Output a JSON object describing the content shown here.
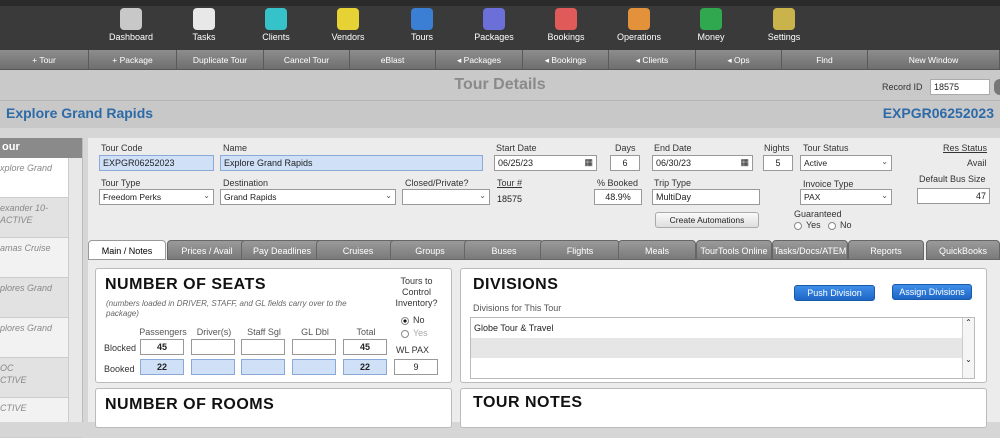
{
  "nav": [
    {
      "label": "Dashboard",
      "icon": "dashboard-icon",
      "color": "#c8c8c8"
    },
    {
      "label": "Tasks",
      "icon": "calendar-icon",
      "color": "#e8e8e8"
    },
    {
      "label": "Clients",
      "icon": "person-pin-icon",
      "color": "#35c3c9"
    },
    {
      "label": "Vendors",
      "icon": "vendor-building-icon",
      "color": "#e7d235"
    },
    {
      "label": "Tours",
      "icon": "globe-icon",
      "color": "#3b7fd4"
    },
    {
      "label": "Packages",
      "icon": "puzzle-icon",
      "color": "#6b6fd8"
    },
    {
      "label": "Bookings",
      "icon": "ticket-icon",
      "color": "#e05a5a"
    },
    {
      "label": "Operations",
      "icon": "operations-icon",
      "color": "#e3913a"
    },
    {
      "label": "Money",
      "icon": "money-icon",
      "color": "#2fa84f"
    },
    {
      "label": "Settings",
      "icon": "gears-icon",
      "color": "#c9b34a"
    }
  ],
  "toolbar": [
    {
      "label": "+ Tour"
    },
    {
      "label": "+ Package"
    },
    {
      "label": "Duplicate Tour"
    },
    {
      "label": "Cancel Tour"
    },
    {
      "label": "eBlast"
    },
    {
      "label": "◂ Packages"
    },
    {
      "label": "◂ Bookings"
    },
    {
      "label": "◂ Clients"
    },
    {
      "label": "◂ Ops"
    },
    {
      "label": "Find"
    },
    {
      "label": "New Window"
    }
  ],
  "header": {
    "title": "Tour Details",
    "record_label": "Record ID",
    "record_id": "18575"
  },
  "titlebar": {
    "name": "Explore Grand Rapids",
    "code": "EXPGR06252023"
  },
  "sidebar": {
    "head": "our",
    "items": [
      "xplore Grand",
      "exander 10-\nACTIVE",
      "amas Cruise",
      "plores Grand",
      "plores Grand",
      "OC\nCTIVE",
      "CTIVE"
    ]
  },
  "form": {
    "tour_code_label": "Tour Code",
    "tour_code": "EXPGR06252023",
    "name_label": "Name",
    "name": "Explore Grand Rapids",
    "start_label": "Start Date",
    "start": "06/25/23",
    "days_label": "Days",
    "days": "6",
    "end_label": "End Date",
    "end": "06/30/23",
    "nights_label": "Nights",
    "nights": "5",
    "status_label": "Tour Status",
    "status": "Active",
    "res_status_label": "Res Status",
    "res_status": "Avail",
    "type_label": "Tour Type",
    "type": "Freedom Perks",
    "dest_label": "Destination",
    "dest": "Grand Rapids",
    "closed_label": "Closed/Private?",
    "closed": "",
    "tournum_label": "Tour #",
    "tournum": "18575",
    "pct_label": "% Booked",
    "pct": "48.9%",
    "trip_label": "Trip Type",
    "trip": "MultiDay",
    "invoice_label": "Invoice Type",
    "invoice": "PAX",
    "bus_label": "Default Bus Size",
    "bus": "47",
    "automations": "Create Automations",
    "guaranteed_label": "Guaranteed",
    "yes": "Yes",
    "no": "No"
  },
  "tabs": [
    "Main / Notes",
    "Prices / Avail",
    "Pay Deadlines",
    "Cruises",
    "Groups",
    "Buses",
    "Flights",
    "Meals",
    "TourTools Online",
    "Tasks/Docs/ATEM",
    "Reports",
    "QuickBooks"
  ],
  "seats": {
    "title": "NUMBER OF SEATS",
    "note": "(numbers loaded in DRIVER, STAFF, and GL fields carry over to the package)",
    "cols": [
      "Passengers",
      "Driver(s)",
      "Staff Sgl",
      "GL Dbl",
      "Total"
    ],
    "blocked_label": "Blocked",
    "booked_label": "Booked",
    "blocked": [
      "45",
      "",
      "",
      "",
      "45"
    ],
    "booked": [
      "22",
      "",
      "",
      "",
      "22"
    ],
    "inv_label": "Tours to Control Inventory?",
    "inv_no": "No",
    "inv_yes": "Yes",
    "wl_label": "WL PAX",
    "wl": "9"
  },
  "divisions": {
    "title": "DIVISIONS",
    "sub": "Divisions for This Tour",
    "push": "Push Division",
    "assign": "Assign Divisions",
    "rows": [
      "Globe Tour & Travel",
      ""
    ]
  },
  "rooms": {
    "title": "NUMBER OF ROOMS"
  },
  "notes": {
    "title": "TOUR NOTES"
  }
}
